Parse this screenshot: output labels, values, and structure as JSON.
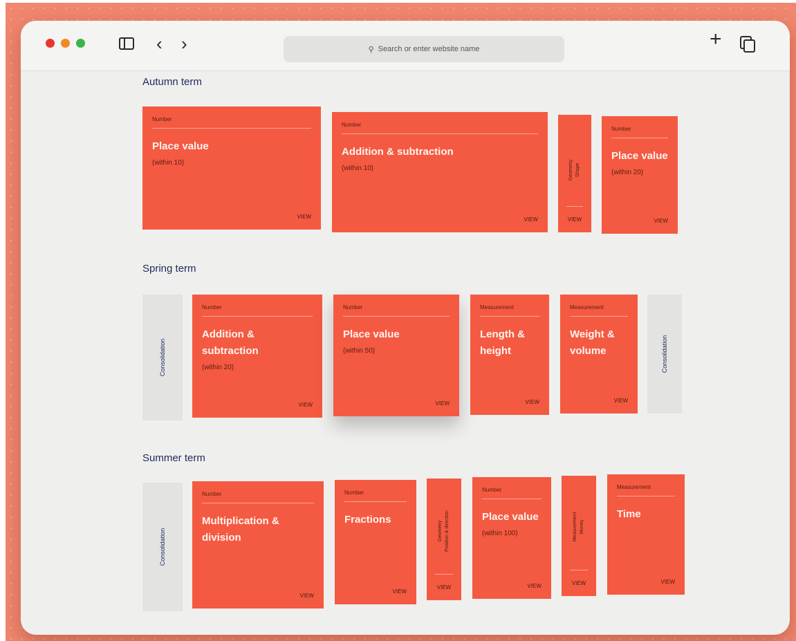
{
  "browser": {
    "search_placeholder": "Search or enter website name"
  },
  "terms": {
    "autumn": {
      "title": "Autumn term",
      "cards": [
        {
          "category": "Number",
          "title": "Place value",
          "sub": "(within 10)",
          "view": "VIEW"
        },
        {
          "category": "Number",
          "title": "Addition & subtraction",
          "sub": "(within 10)",
          "view": "VIEW"
        },
        {
          "category": "Geometry",
          "title": "Shape",
          "view": "VIEW"
        },
        {
          "category": "Number",
          "title": "Place value",
          "sub": "(within 20)",
          "view": "VIEW"
        }
      ]
    },
    "spring": {
      "title": "Spring term",
      "consolidation_left": "Consolidation",
      "consolidation_right": "Consolidation",
      "cards": [
        {
          "category": "Number",
          "title_line1": "Addition &",
          "title_line2": "subtraction",
          "sub": "(within 20)",
          "view": "VIEW"
        },
        {
          "category": "Number",
          "title": "Place value",
          "sub": "(within 50)",
          "view": "VIEW"
        },
        {
          "category": "Measurement",
          "title_line1": "Length &",
          "title_line2": "height",
          "view": "VIEW"
        },
        {
          "category": "Measurement",
          "title_line1": "Weight &",
          "title_line2": "volume",
          "view": "VIEW"
        }
      ]
    },
    "summer": {
      "title": "Summer term",
      "consolidation": "Consolidation",
      "cards": [
        {
          "category": "Number",
          "title_line1": "Multiplication &",
          "title_line2": "division",
          "view": "VIEW"
        },
        {
          "category": "Number",
          "title": "Fractions",
          "view": "VIEW"
        },
        {
          "category": "Geometry",
          "title": "Position & direction",
          "view": "VIEW"
        },
        {
          "category": "Number",
          "title": "Place value",
          "sub": "(within 100)",
          "view": "VIEW"
        },
        {
          "category": "Measurement",
          "title": "Money",
          "view": "VIEW"
        },
        {
          "category": "Measurement",
          "title": "Time",
          "view": "VIEW"
        }
      ]
    }
  },
  "colors": {
    "card": "#f45a41",
    "backdrop": "#f0876e",
    "heading": "#1f2a5a"
  }
}
